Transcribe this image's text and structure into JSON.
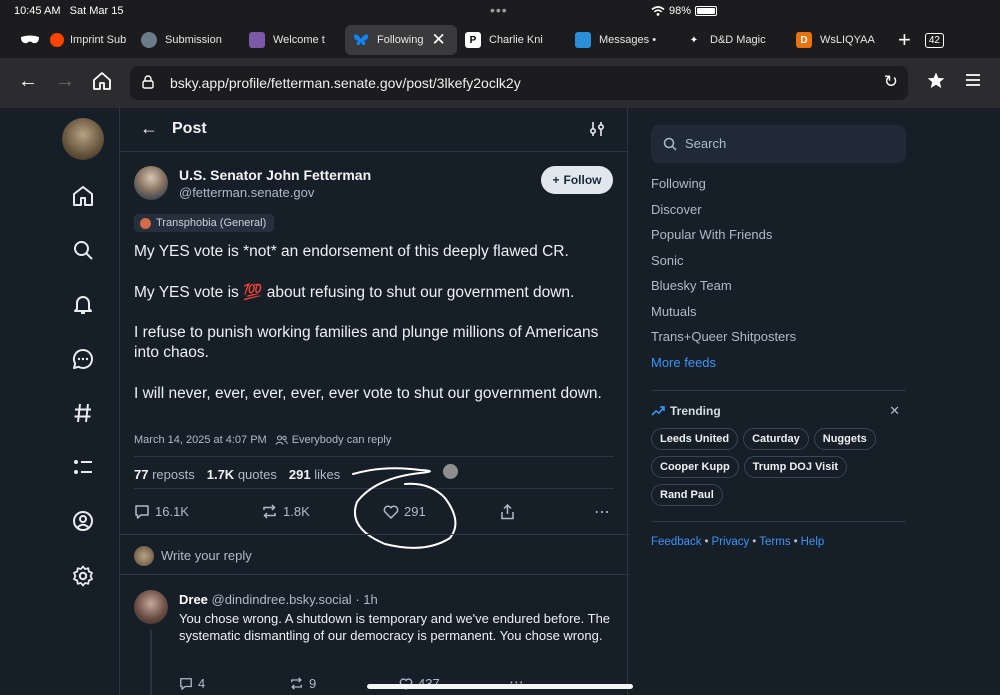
{
  "status_bar": {
    "time": "10:45 AM",
    "date": "Sat Mar 15",
    "battery": "98%"
  },
  "tabs": [
    {
      "label": "Imprint Sub",
      "icon": "mask-icon",
      "active": false
    },
    {
      "label": "Submission",
      "icon": "globe-icon",
      "active": false
    },
    {
      "label": "Welcome t",
      "icon": "shield-cat-icon",
      "active": false
    },
    {
      "label": "Following",
      "icon": "bluesky-butterfly-icon",
      "active": true
    },
    {
      "label": "Charlie Kni",
      "icon": "patreon-icon",
      "active": false
    },
    {
      "label": "Messages •",
      "icon": "chat-icon",
      "active": false
    },
    {
      "label": "D&D Magic",
      "icon": "d20-icon",
      "active": false
    },
    {
      "label": "WsLIQYAA",
      "icon": "d-letter-icon",
      "active": false
    }
  ],
  "tab_count": "42",
  "url": "bsky.app/profile/fetterman.senate.gov/post/3lkefy2oclk2y",
  "page_title": "Post",
  "post": {
    "author_name": "U.S. Senator John Fetterman",
    "author_handle": "@fetterman.senate.gov",
    "follow_label": "Follow",
    "label": "Transphobia (General)",
    "paragraphs": [
      "My YES vote is *not* an endorsement of this deeply flawed CR.",
      "My YES vote is 💯 about refusing to shut our government down.",
      "I refuse to punish working families and plunge millions of Americans into chaos.",
      "I will never, ever, ever, ever, ever vote to shut our government down."
    ],
    "timestamp": "March 14, 2025 at 4:07 PM",
    "reply_setting": "Everybody can reply",
    "stats": {
      "reposts_count": "77",
      "reposts_label": "reposts",
      "quotes_count": "1.7K",
      "quotes_label": "quotes",
      "likes_count": "291",
      "likes_label": "likes"
    },
    "actions": {
      "replies": "16.1K",
      "reposts": "1.8K",
      "likes": "291"
    }
  },
  "reply_placeholder": "Write your reply",
  "reply": {
    "name": "Dree",
    "handle": "@dindindree.bsky.social",
    "time": "· 1h",
    "text": "You chose wrong. A shutdown is temporary and we've endured before. The systematic dismantling of our democracy is permanent. You chose wrong.",
    "replies": "4",
    "reposts": "9",
    "likes": "437"
  },
  "sidebar": {
    "search_placeholder": "Search",
    "feeds": [
      "Following",
      "Discover",
      "Popular With Friends",
      "Sonic",
      "Bluesky Team",
      "Mutuals",
      "Trans+Queer Shitposters"
    ],
    "more_feeds": "More feeds",
    "trending_title": "Trending",
    "trending": [
      "Leeds United",
      "Caturday",
      "Nuggets",
      "Cooper Kupp",
      "Trump DOJ Visit",
      "Rand Paul"
    ],
    "footer": [
      "Feedback",
      "Privacy",
      "Terms",
      "Help"
    ]
  },
  "colors": {
    "background": "#161e27",
    "accent": "#3d94f6",
    "annotation_ink": "#ffffff"
  }
}
